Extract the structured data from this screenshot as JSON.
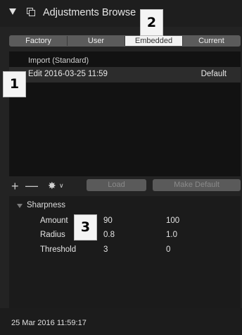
{
  "panel": {
    "title": "Adjustments Browse"
  },
  "tabs": [
    {
      "label": "Factory"
    },
    {
      "label": "User"
    },
    {
      "label": "Embedded"
    },
    {
      "label": "Current"
    }
  ],
  "list": {
    "header": "Import (Standard)",
    "selected_row": {
      "name": "Edit 2016-03-25 11:59",
      "tag": "Default"
    }
  },
  "toolbar": {
    "add_icon": "plus-icon",
    "remove_icon": "minus-icon",
    "action_icon": "gear-icon",
    "load_label": "Load",
    "make_default_label": "Make Default"
  },
  "section": {
    "title": "Sharpness",
    "rows": [
      {
        "name": "Amount",
        "value": "90",
        "default": "100"
      },
      {
        "name": "Radius",
        "value": "0.8",
        "default": "1.0"
      },
      {
        "name": "Threshold",
        "value": "3",
        "default": "0"
      }
    ]
  },
  "footer": {
    "date": "25 Mar 2016 11:59:17"
  },
  "badges": [
    "1",
    "2",
    "3"
  ],
  "colors": {
    "background": "#232323",
    "list_bg": "#121212",
    "selected_row": "#2c2c2c",
    "tab_active": "#f2f2f2"
  }
}
